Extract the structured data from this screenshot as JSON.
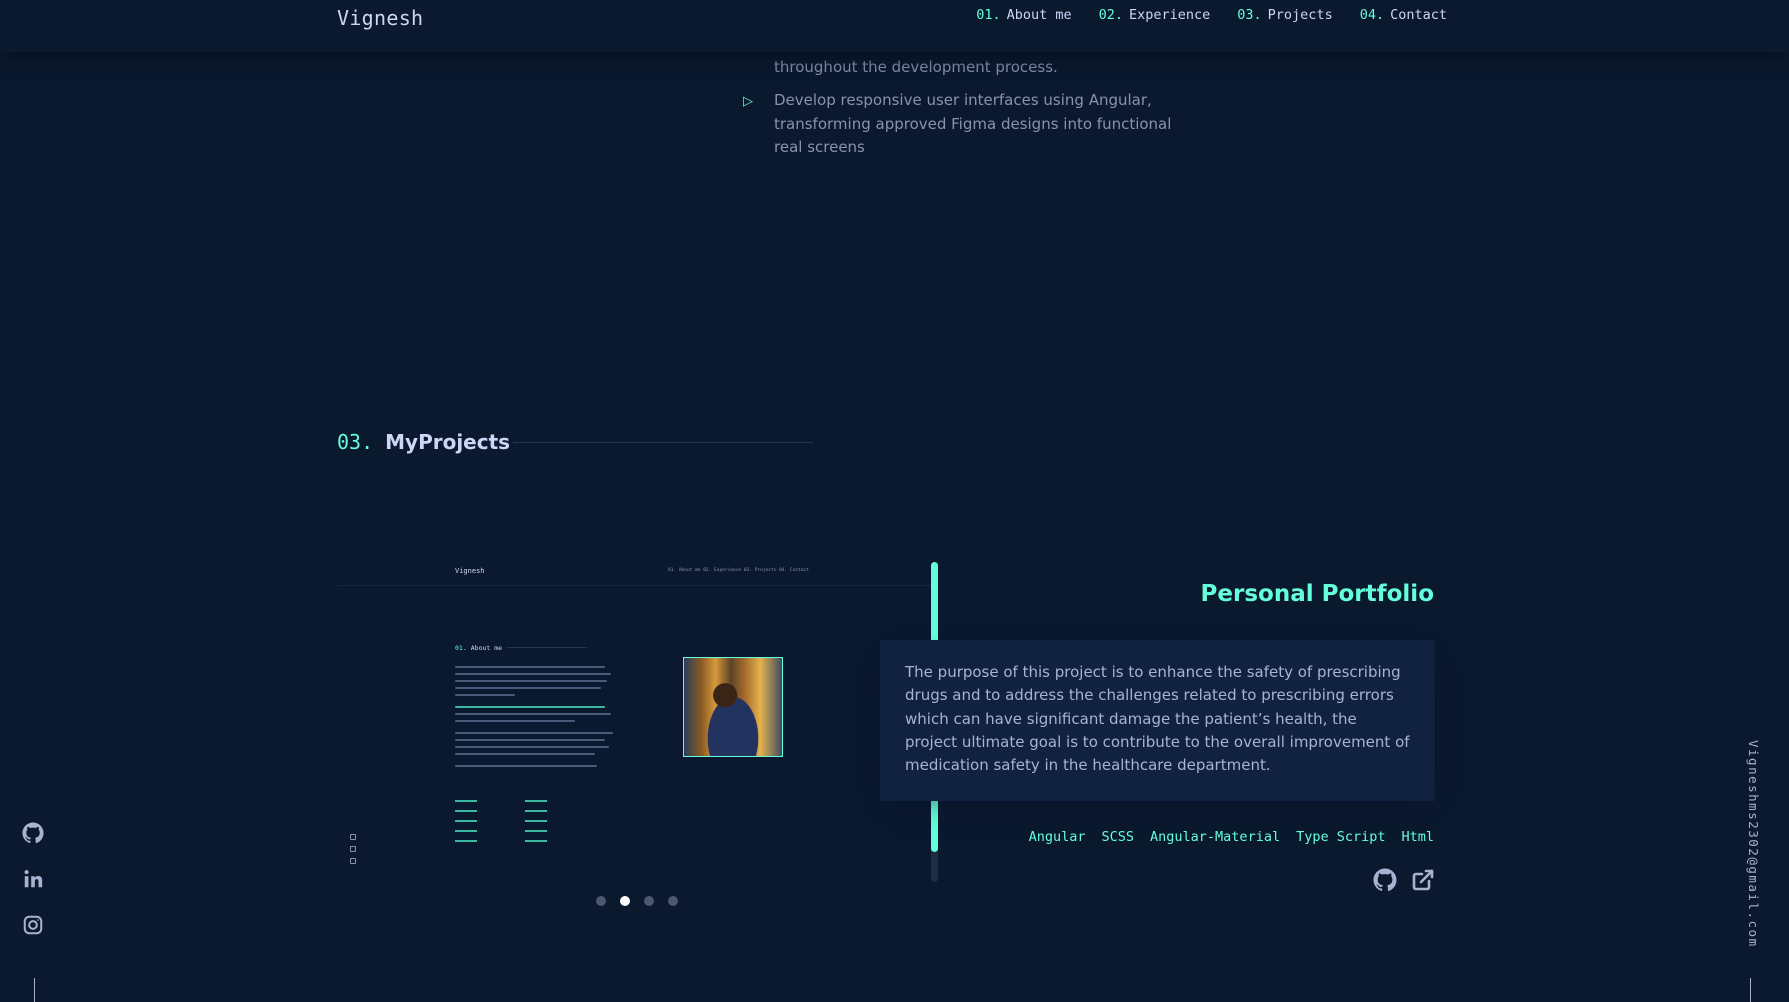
{
  "nav": {
    "brand": "Vignesh",
    "links": [
      {
        "num": "01.",
        "label": "About me"
      },
      {
        "num": "02.",
        "label": "Experience"
      },
      {
        "num": "03.",
        "label": "Projects"
      },
      {
        "num": "04.",
        "label": "Contact"
      }
    ]
  },
  "experience": {
    "continued_text": "throughout the development process.",
    "bullet": "Develop responsive user interfaces using Angular, transforming approved Figma designs into functional real screens"
  },
  "projects_section": {
    "number": "03.",
    "title": "MyProjects"
  },
  "preview": {
    "brand": "Vignesh",
    "nav": "01. About me   02. Experience   03. Projects   04. Contact",
    "heading_num": "01.",
    "heading_title": "About me",
    "carousel": {
      "slides": 4,
      "active_index": 1
    }
  },
  "project": {
    "title": "Personal Portfolio",
    "description": "The purpose of this project is to enhance the safety of prescribing drugs and to address the challenges related to prescribing errors which can have significant damage the patient’s health, the project ultimate goal is to contribute to the overall improvement of medication safety in the healthcare department.",
    "tech": [
      "Angular",
      "SCSS",
      "Angular-Material",
      "Type Script",
      "Html"
    ],
    "links": [
      "github-icon",
      "external-link-icon"
    ]
  },
  "sidebar": {
    "socials": [
      "github-icon",
      "linkedin-icon",
      "instagram-icon"
    ],
    "email": "Vigneshms2302@gmail.com"
  },
  "colors": {
    "background": "#0b192f",
    "accent": "#64ffda",
    "card": "#112240",
    "text": "#8892b0",
    "heading": "#ccd6f6"
  }
}
